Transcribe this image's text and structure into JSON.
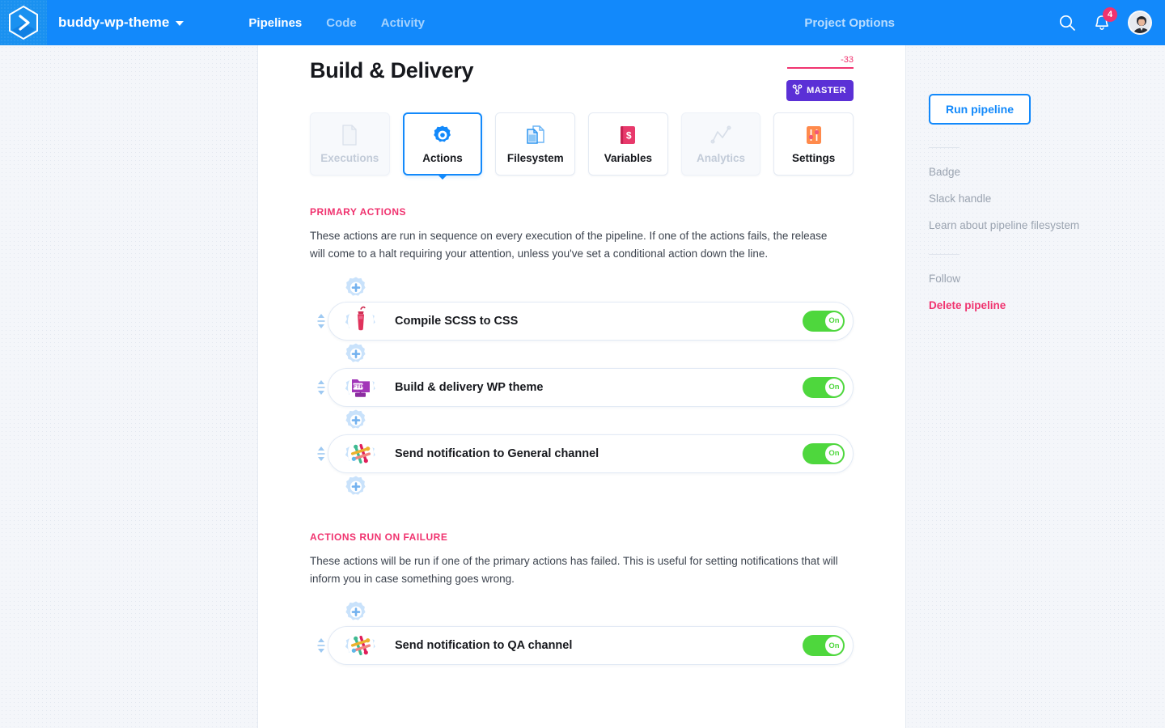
{
  "topbar": {
    "logo_icon": "buddy-hexagon-logo",
    "project_name": "buddy-wp-theme",
    "nav": [
      {
        "label": "Pipelines",
        "active": true
      },
      {
        "label": "Code",
        "active": false
      },
      {
        "label": "Activity",
        "active": false
      }
    ],
    "project_options_label": "Project Options",
    "search_icon": "search-icon",
    "notifications_icon": "bell-icon",
    "notifications_count": "4",
    "avatar_icon": "user-avatar"
  },
  "header": {
    "title": "Build & Delivery",
    "execution_number": "-33",
    "branch_icon": "branch-icon",
    "branch_label": "MASTER"
  },
  "tabs": [
    {
      "label": "Executions",
      "icon": "document-icon",
      "state": "disabled"
    },
    {
      "label": "Actions",
      "icon": "cog-icon",
      "state": "active"
    },
    {
      "label": "Filesystem",
      "icon": "files-icon",
      "state": "normal"
    },
    {
      "label": "Variables",
      "icon": "dollar-book-icon",
      "state": "normal"
    },
    {
      "label": "Analytics",
      "icon": "line-chart-icon",
      "state": "disabled"
    },
    {
      "label": "Settings",
      "icon": "sliders-icon",
      "state": "normal"
    }
  ],
  "sections": [
    {
      "title": "PRIMARY ACTIONS",
      "description": "These actions are run in sequence on every execution of the pipeline. If one of the actions fails, the release will come to a halt requiring your attention, unless you've set a conditional action down the line.",
      "actions": [
        {
          "label": "Compile SCSS to CSS",
          "icon": "sass-icon",
          "toggle_label": "On",
          "toggle_on": true
        },
        {
          "label": "Build & delivery WP theme",
          "icon": "ftp-icon",
          "toggle_label": "On",
          "toggle_on": true
        },
        {
          "label": "Send notification to General channel",
          "icon": "slack-icon",
          "toggle_label": "On",
          "toggle_on": true
        }
      ]
    },
    {
      "title": "ACTIONS RUN ON FAILURE",
      "description": "These actions will be run if one of the primary actions has failed. This is useful for setting notifications that will inform you in case something goes wrong.",
      "actions": [
        {
          "label": "Send notification to QA channel",
          "icon": "slack-icon",
          "toggle_label": "On",
          "toggle_on": true
        }
      ]
    }
  ],
  "sidebar": {
    "run_button": "Run pipeline",
    "links_group_1": [
      {
        "label": "Badge"
      },
      {
        "label": "Slack handle"
      },
      {
        "label": "Learn about pipeline filesystem"
      }
    ],
    "links_group_2": [
      {
        "label": "Follow"
      },
      {
        "label": "Delete pipeline"
      }
    ]
  },
  "colors": {
    "brand_blue": "#1289fb",
    "accent_pink": "#f0336f",
    "branch_purple": "#5b30d6",
    "toggle_green": "#4ed73d"
  }
}
